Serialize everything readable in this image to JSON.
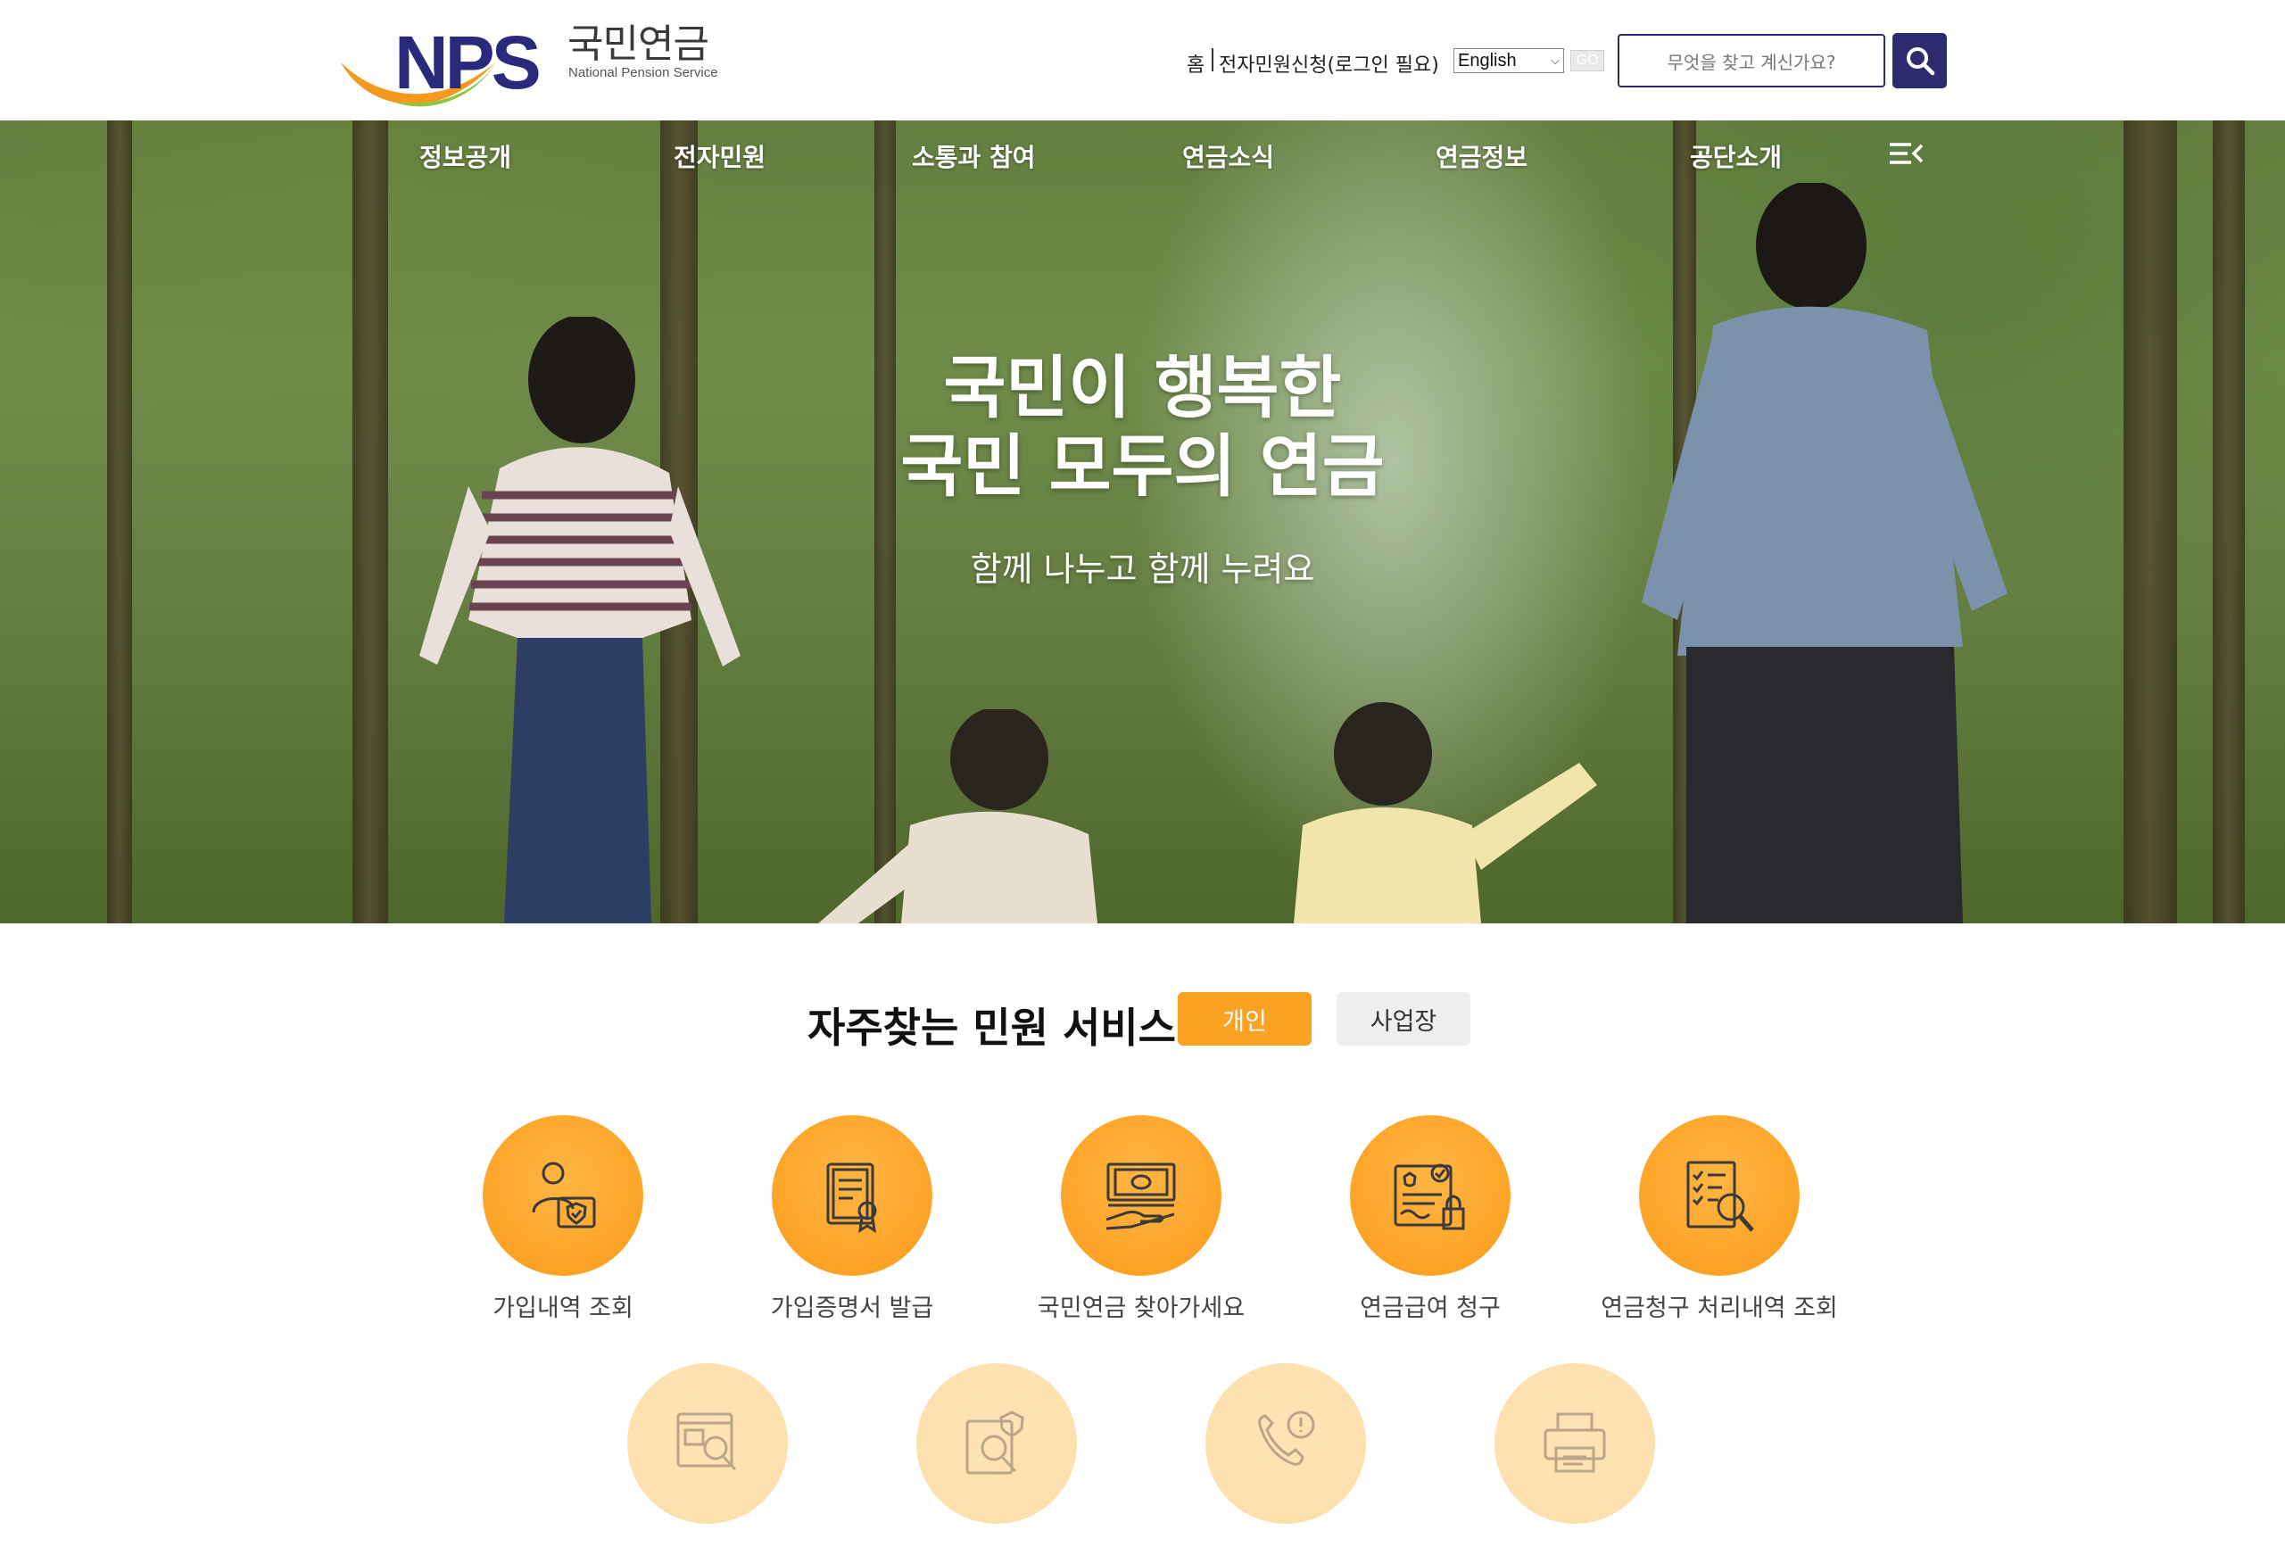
{
  "brand": {
    "logo_main": "NPS",
    "logo_ko": "국민연금",
    "logo_en": "National Pension Service",
    "colors": {
      "navy": "#2d2a6e",
      "orange": "#fba223",
      "green": "#8dc63f"
    }
  },
  "utility": {
    "home": "홈",
    "ecivil": "전자민원신청(로그인 필요)",
    "language": "English",
    "go": "GO",
    "search_placeholder": "무엇을 찾고 계신가요?",
    "search_icon": "search-icon"
  },
  "nav": {
    "items": [
      "정보공개",
      "전자민원",
      "소통과 참여",
      "연금소식",
      "연금정보",
      "공단소개"
    ],
    "menu_icon": "menu-icon"
  },
  "hero": {
    "title_line1": "국민이 행복한",
    "title_line2": "국민 모두의 연금",
    "subtitle": "함께 나누고 함께 누려요"
  },
  "services": {
    "title": "자주찾는 민원 서비스",
    "tabs": {
      "personal": "개인",
      "business": "사업장"
    },
    "items": [
      {
        "label": "가입내역 조회",
        "icon": "member-shield-icon"
      },
      {
        "label": "가입증명서 발급",
        "icon": "certificate-icon"
      },
      {
        "label": "국민연금 찾아가세요",
        "icon": "money-hand-icon"
      },
      {
        "label": "연금급여 청구",
        "icon": "claim-document-icon"
      },
      {
        "label": "연금청구 처리내역 조회",
        "icon": "checklist-search-icon"
      }
    ],
    "items_row2": [
      {
        "icon": "document-search-icon"
      },
      {
        "icon": "security-search-icon"
      },
      {
        "icon": "phone-alert-icon"
      },
      {
        "icon": "printer-icon"
      }
    ]
  }
}
